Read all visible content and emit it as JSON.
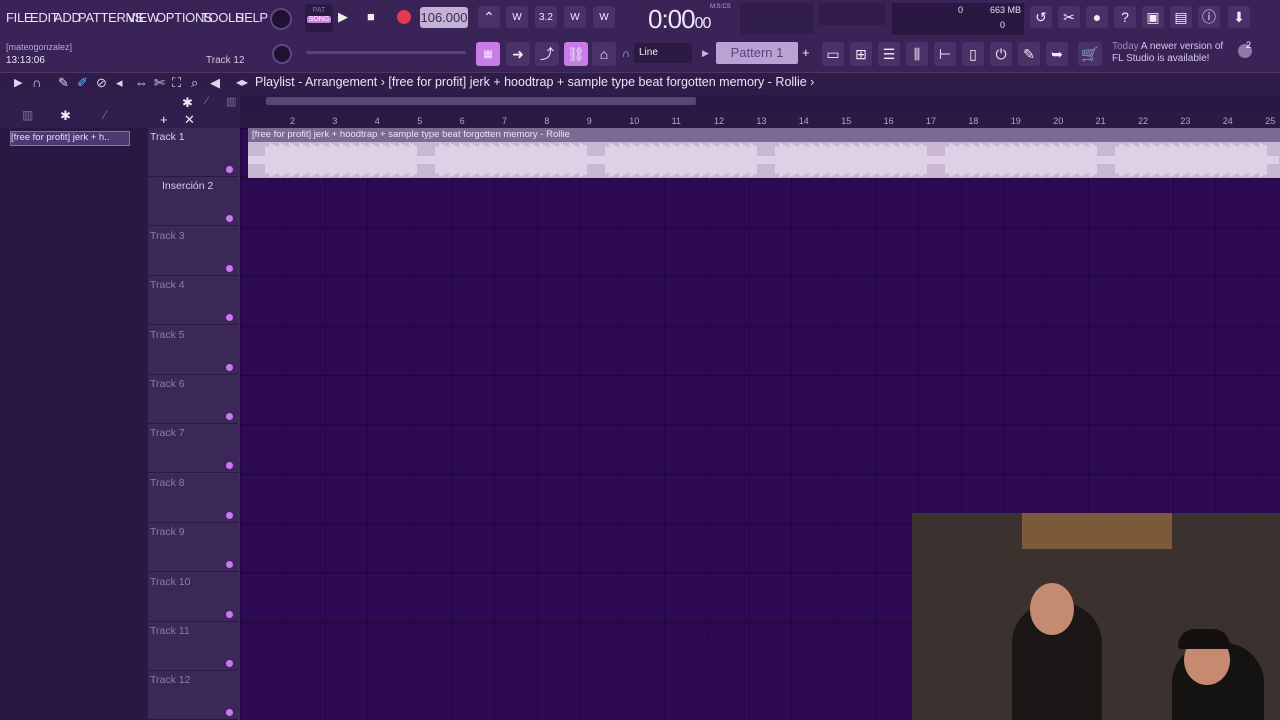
{
  "menu": [
    "FILE",
    "EDIT",
    "ADD",
    "PATTERNS",
    "VIEW",
    "OPTIONS",
    "TOOLS",
    "HELP"
  ],
  "transport": {
    "pat_label": "PAT",
    "song_label": "SONG",
    "tempo": "106.000",
    "time_main": "0:00",
    "time_sub": "00",
    "time_unit": "M:S:CS",
    "cpu": "0",
    "memory": "663 MB",
    "poly": "0"
  },
  "info": {
    "user": "[mateogonzalez]",
    "clock": "13:13:06",
    "hint_track": "Track 12"
  },
  "toolbar": {
    "snap": "Line",
    "pattern": "Pattern 1",
    "news_day": "Today",
    "news_text": "A newer version of FL Studio is available!",
    "news_badge": "2"
  },
  "playlist": {
    "title": "Playlist - Arrangement",
    "project": "[free for profit] jerk + hoodtrap + sample type beat forgotten memory - Rollie",
    "clip_short": "[free for profit] jerk + h..",
    "clip_name": "[free for profit] jerk + hoodtrap + sample type beat forgotten memory - Rollie"
  },
  "ruler": [
    "2",
    "3",
    "4",
    "5",
    "6",
    "7",
    "8",
    "9",
    "10",
    "11",
    "12",
    "13",
    "14",
    "15",
    "16",
    "17",
    "18",
    "19",
    "20",
    "21",
    "22",
    "23",
    "24",
    "25"
  ],
  "tracks": [
    "Track 1",
    "Inserción 2",
    "Track 3",
    "Track 4",
    "Track 5",
    "Track 6",
    "Track 7",
    "Track 8",
    "Track 9",
    "Track 10",
    "Track 11",
    "Track 12"
  ],
  "colors": {
    "accent": "#c77ce6",
    "grid": "#2e0a55",
    "clip": "#c8b6d4"
  }
}
